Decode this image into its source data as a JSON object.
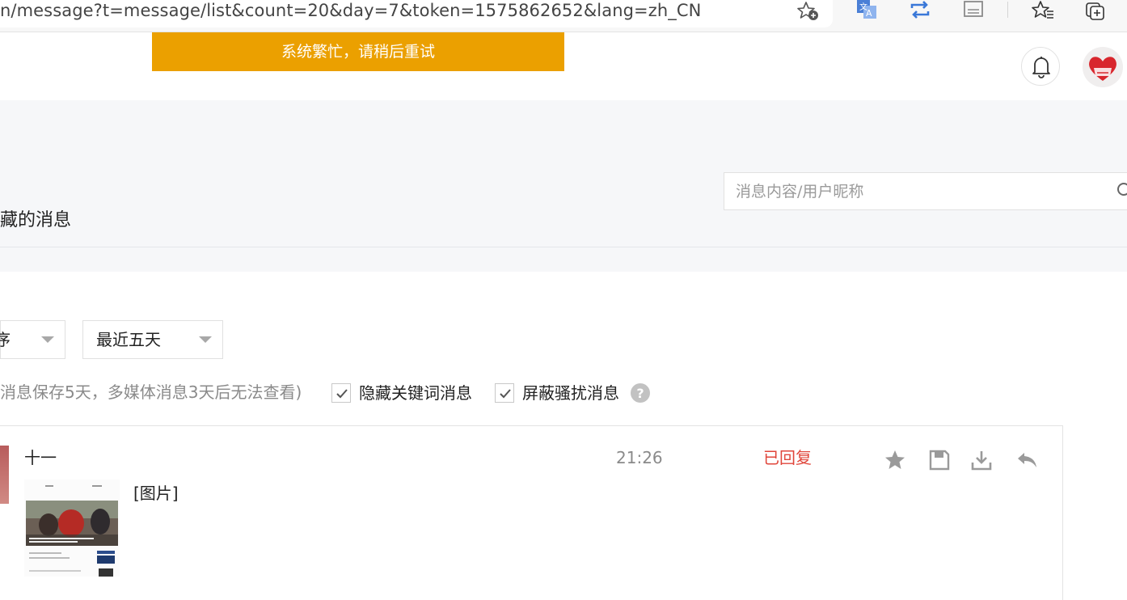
{
  "browser": {
    "url": "n/message?t=message/list&count=20&day=7&token=1575862652&lang=zh_CN"
  },
  "toast": {
    "text": "系统繁忙，请稍后重试"
  },
  "tab": {
    "title": "藏的消息"
  },
  "search": {
    "placeholder": "消息内容/用户昵称",
    "value": ""
  },
  "filters": {
    "sort_selected": "序",
    "day_selected": "最近五天"
  },
  "note": "消息保存5天，多媒体消息3天后无法查看)",
  "checkboxes": [
    {
      "label": "隐藏关键词消息",
      "checked": true
    },
    {
      "label": "屏蔽骚扰消息",
      "checked": true
    }
  ],
  "messages": [
    {
      "sender": "十一",
      "time": "21:26",
      "status": "已回复",
      "content": "[图片]"
    }
  ],
  "colors": {
    "toast_bg": "#eba000",
    "status_replied": "#e0463b",
    "band_bg": "#f6f7f9"
  },
  "icons": [
    "favorite-add-icon",
    "translate-icon",
    "sync-icon",
    "reader-icon",
    "favorites-icon",
    "collections-icon",
    "bell-icon",
    "search-icon",
    "help-icon",
    "star-icon",
    "save-icon",
    "download-icon",
    "reply-icon"
  ]
}
